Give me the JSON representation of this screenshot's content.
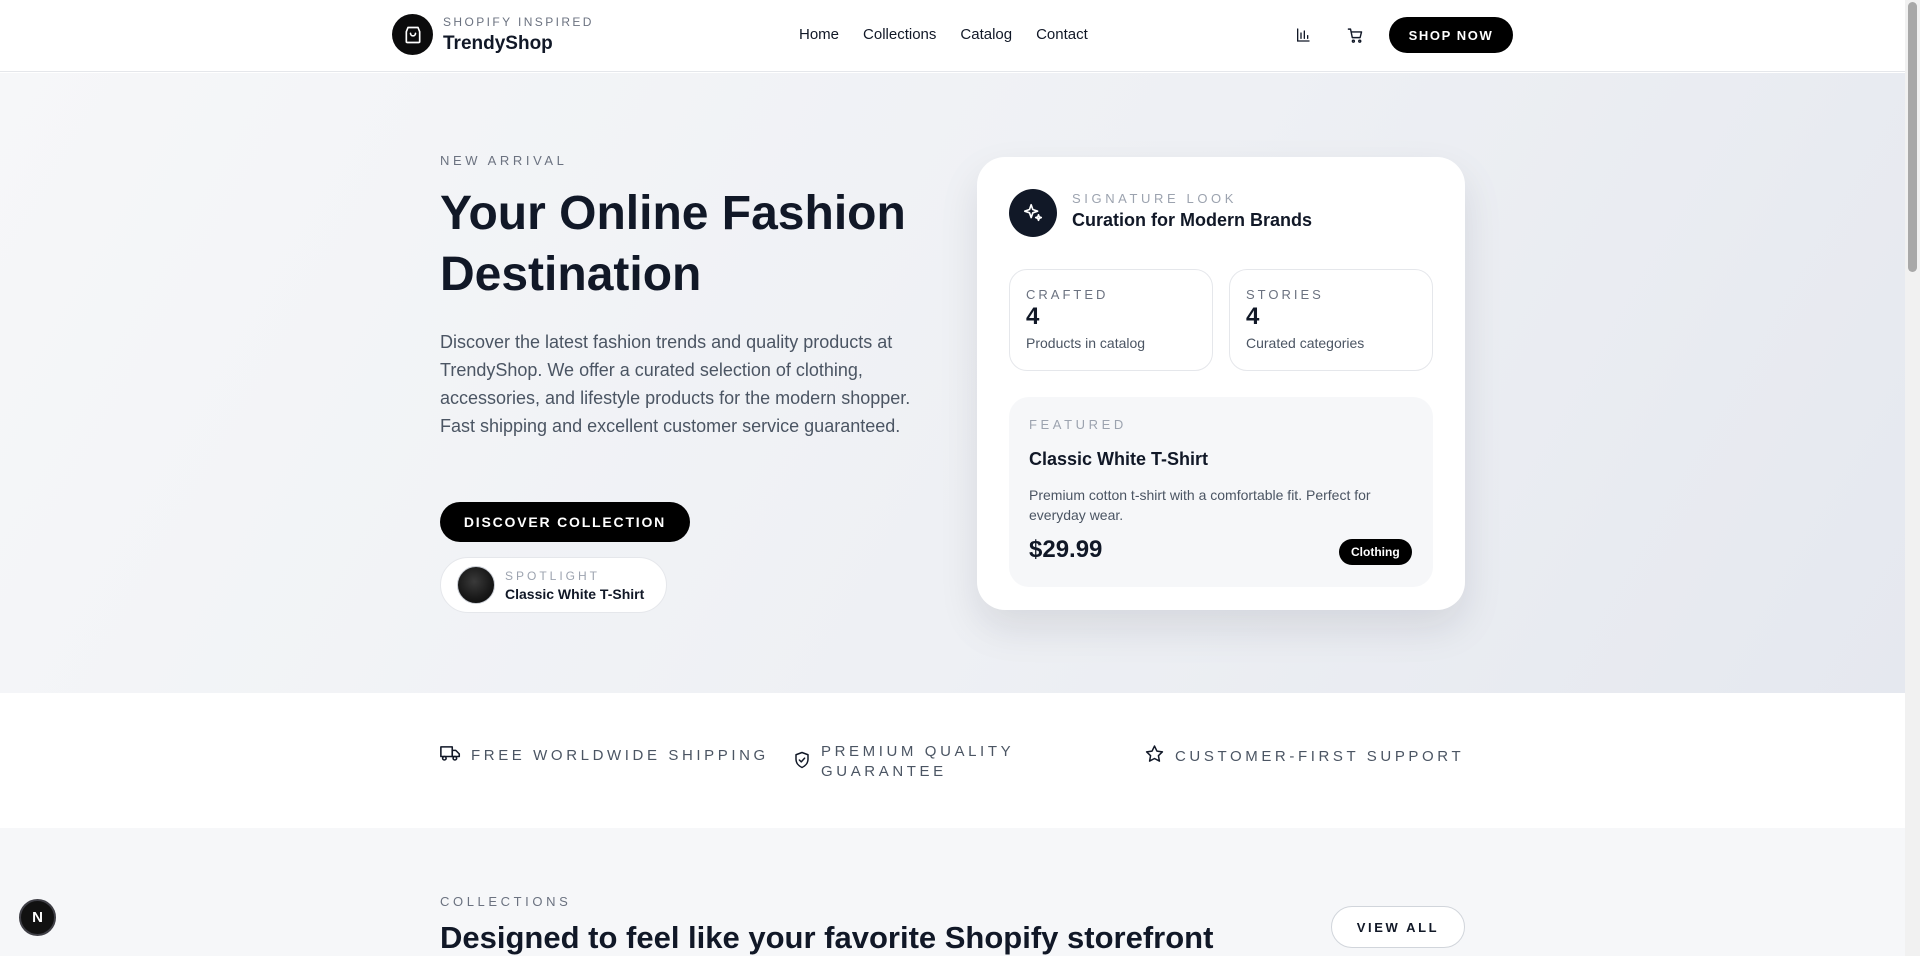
{
  "header": {
    "brand_kicker": "SHOPIFY INSPIRED",
    "brand_name": "TrendyShop",
    "nav": [
      "Home",
      "Collections",
      "Catalog",
      "Contact"
    ],
    "shop_now": "SHOP NOW",
    "icons": [
      "bag-icon",
      "bar-chart-icon",
      "cart-icon"
    ]
  },
  "hero": {
    "eyebrow": "NEW ARRIVAL",
    "title": "Your Online Fashion Destination",
    "description": "Discover the latest fashion trends and quality products at TrendyShop. We offer a curated selection of clothing, accessories, and lifestyle products for the modern shopper. Fast shipping and excellent customer service guaranteed.",
    "cta": "DISCOVER COLLECTION",
    "spotlight": {
      "kicker": "SPOTLIGHT",
      "name": "Classic White T-Shirt"
    }
  },
  "card": {
    "kicker": "SIGNATURE LOOK",
    "title": "Curation for Modern Brands",
    "stats": [
      {
        "kicker": "CRAFTED",
        "value": "4",
        "label": "Products in catalog"
      },
      {
        "kicker": "STORIES",
        "value": "4",
        "label": "Curated categories"
      }
    ],
    "featured": {
      "kicker": "FEATURED",
      "name": "Classic White T-Shirt",
      "description": "Premium cotton t-shirt with a comfortable fit. Perfect for everyday wear.",
      "price": "$29.99",
      "category": "Clothing"
    }
  },
  "features": [
    {
      "icon": "truck-icon",
      "line1": "FREE WORLDWIDE SHIPPING",
      "line2": ""
    },
    {
      "icon": "shield-check-icon",
      "line1": "PREMIUM QUALITY",
      "line2": "GUARANTEE"
    },
    {
      "icon": "star-icon",
      "line1": "CUSTOMER-FIRST SUPPORT",
      "line2": ""
    }
  ],
  "collections": {
    "eyebrow": "COLLECTIONS",
    "title": "Designed to feel like your favorite Shopify storefront",
    "view_all": "VIEW ALL"
  },
  "dev_badge": "N"
}
